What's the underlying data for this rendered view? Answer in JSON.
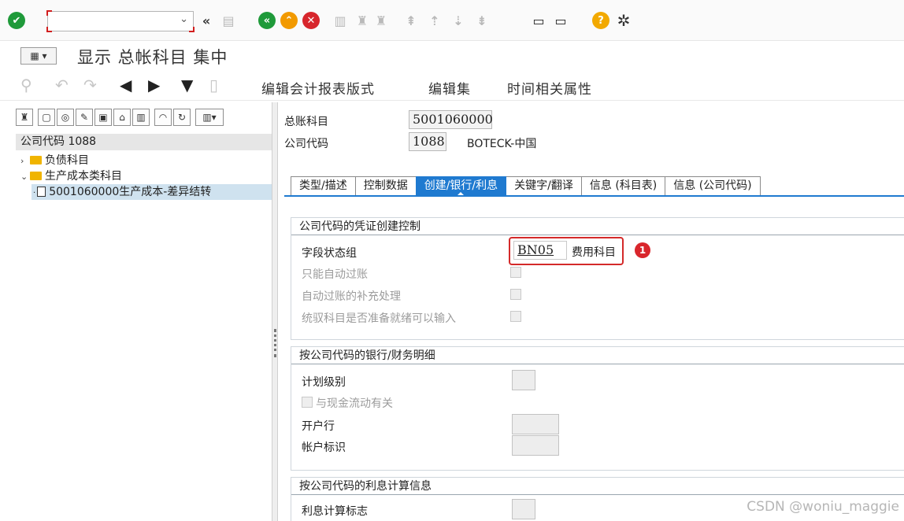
{
  "toolbar1": {
    "icons": [
      "enter-check-icon",
      "back-double-arrow-icon",
      "save-icon",
      "back-icon",
      "exit-icon",
      "cancel-icon",
      "print-icon",
      "find-icon",
      "find-next-icon",
      "first-page-icon",
      "previous-page-icon",
      "next-page-icon",
      "last-page-icon",
      "new-session-icon",
      "shortcut-icon",
      "help-icon",
      "settings-gear-icon"
    ],
    "command_value": "",
    "help_glyph": "?"
  },
  "title": {
    "text": "显示 总帐科目 集中"
  },
  "toolbar3": {
    "buttons": [
      "编辑会计报表版式",
      "编辑集",
      "时间相关属性"
    ]
  },
  "tree": {
    "header": "公司代码 1088",
    "items": [
      {
        "label": "负债科目"
      },
      {
        "label": "生产成本类科目"
      },
      {
        "label": "5001060000生产成本-差异结转"
      }
    ]
  },
  "header_fields": {
    "account_label": "总账科目",
    "account_value": "5001060000",
    "company_label": "公司代码",
    "company_value": "1088",
    "company_name": "BOTECK-中国"
  },
  "tabs": [
    "类型/描述",
    "控制数据",
    "创建/银行/利息",
    "关键字/翻译",
    "信息 (科目表)",
    "信息 (公司代码)"
  ],
  "active_tab_index": 2,
  "group1": {
    "title": "公司代码的凭证创建控制",
    "field_status_label": "字段状态组",
    "field_status_value": "BN05",
    "field_status_desc": "费用科目",
    "badge": "1",
    "auto_post_label": "只能自动过账",
    "supplement_label": "自动过账的补充处理",
    "recon_label": "统驭科目是否准备就绪可以输入"
  },
  "group2": {
    "title": "按公司代码的银行/财务明细",
    "plan_level_label": "计划级别",
    "cashflow_label": "与现金流动有关",
    "house_bank_label": "开户行",
    "account_id_label": "帐户标识"
  },
  "group3": {
    "title": "按公司代码的利息计算信息",
    "interest_label": "利息计算标志"
  },
  "watermark": "CSDN @woniu_maggie",
  "colors": {
    "active_tab": "#1f7ad0",
    "highlight": "#d42a2a",
    "folder": "#f0b400"
  }
}
